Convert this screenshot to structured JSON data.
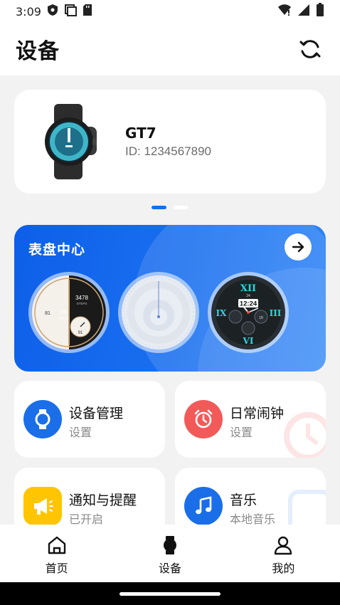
{
  "status_bar": {
    "time": "3:09"
  },
  "header": {
    "title": "设备"
  },
  "device": {
    "name": "GT7",
    "id_text": "ID: 1234567890"
  },
  "pager": {
    "count": 2,
    "active": 0
  },
  "dial_center": {
    "title": "表盘中心",
    "faces": [
      {
        "name": "face-1",
        "steps": "3478",
        "steps_label": "STEPS",
        "day": "28",
        "weekday": "WED",
        "left_num": "81",
        "bottom_num": "91"
      },
      {
        "name": "face-2"
      },
      {
        "name": "face-3",
        "time": "12:24",
        "top_num": "24",
        "right_num": "18"
      }
    ]
  },
  "tiles": [
    {
      "title": "设备管理",
      "subtitle": "设置",
      "icon": "watch-icon",
      "color": "#1a6ee8"
    },
    {
      "title": "日常闹钟",
      "subtitle": "设置",
      "icon": "alarm-clock-icon",
      "color": "#f25a5a"
    },
    {
      "title": "通知与提醒",
      "subtitle": "已开启",
      "icon": "megaphone-icon",
      "color": "#ffc500"
    },
    {
      "title": "音乐",
      "subtitle": "本地音乐",
      "icon": "music-note-icon",
      "color": "#1a6ee8"
    }
  ],
  "nav": {
    "items": [
      {
        "label": "首页",
        "icon": "home-icon",
        "active": false
      },
      {
        "label": "设备",
        "icon": "watch-icon",
        "active": true
      },
      {
        "label": "我的",
        "icon": "user-icon",
        "active": false
      }
    ]
  }
}
